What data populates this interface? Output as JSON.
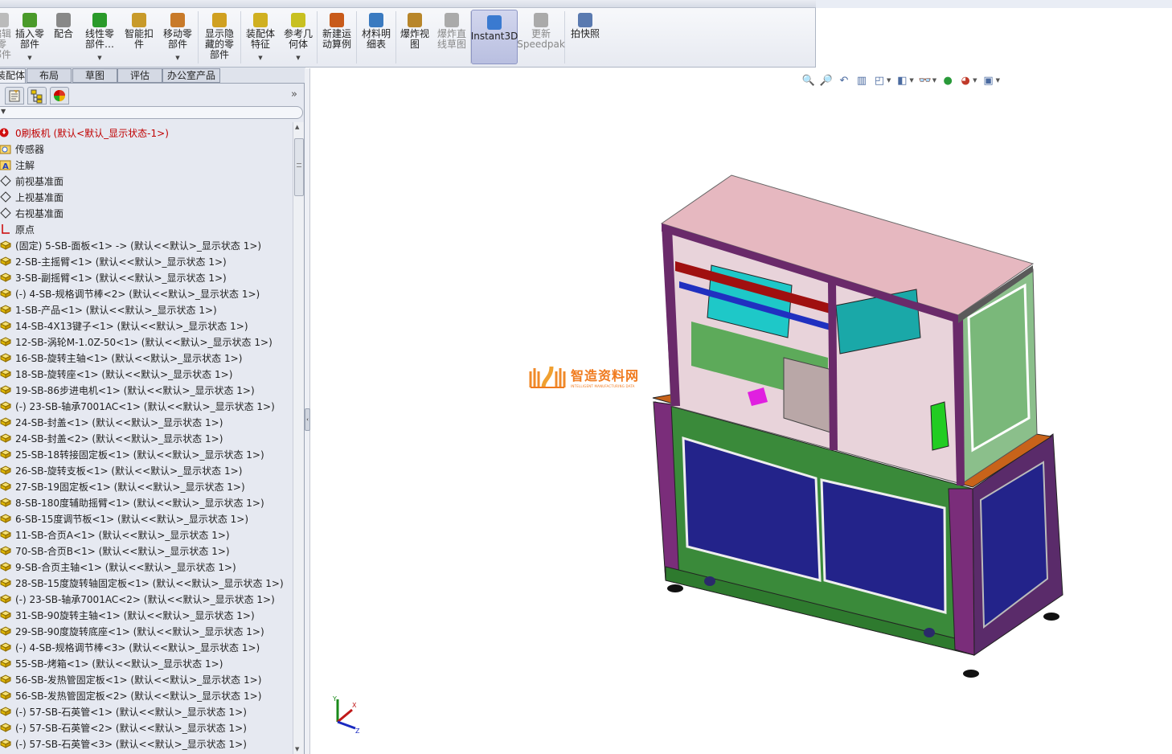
{
  "ribbon": {
    "items": [
      {
        "label": "编辑零\n部件",
        "disabled": true
      },
      {
        "label": "插入零\n部件",
        "dropdown": true
      },
      {
        "label": "配合"
      },
      {
        "label": "线性零\n部件…",
        "dropdown": true
      },
      {
        "label": "智能扣\n件"
      },
      {
        "label": "移动零\n部件",
        "dropdown": true
      },
      {
        "label": "显示隐\n藏的零\n部件"
      },
      {
        "label": "装配体\n特征",
        "dropdown": true
      },
      {
        "label": "参考几\n何体",
        "dropdown": true
      },
      {
        "label": "新建运\n动算例"
      },
      {
        "label": "材料明\n细表"
      },
      {
        "label": "爆炸视\n图"
      },
      {
        "label": "爆炸直\n线草图",
        "disabled": true
      },
      {
        "label": "Instant3D",
        "active": true
      },
      {
        "label": "更新\nSpeedpak",
        "disabled": true
      },
      {
        "label": "拍快照"
      }
    ]
  },
  "tabs": [
    {
      "label": "装配体",
      "active": true
    },
    {
      "label": "布局"
    },
    {
      "label": "草图"
    },
    {
      "label": "评估"
    },
    {
      "label": "办公室产品"
    }
  ],
  "panel_tools": [
    "property-manager-icon",
    "configuration-manager-icon",
    "display-manager-icon"
  ],
  "panel_expand": "»",
  "tree": {
    "root": "0刷板机  (默认<默认_显示状态-1>)",
    "items": [
      {
        "label": "传感器",
        "icon": "sensor-folder"
      },
      {
        "label": "注解",
        "icon": "annotation-folder"
      },
      {
        "label": "前视基准面",
        "icon": "plane"
      },
      {
        "label": "上视基准面",
        "icon": "plane"
      },
      {
        "label": "右视基准面",
        "icon": "plane"
      },
      {
        "label": "原点",
        "icon": "origin"
      },
      {
        "label": "(固定) 5-SB-面板<1> -> (默认<<默认>_显示状态 1>)",
        "icon": "part"
      },
      {
        "label": "2-SB-主摇臂<1> (默认<<默认>_显示状态 1>)",
        "icon": "part"
      },
      {
        "label": "3-SB-副摇臂<1> (默认<<默认>_显示状态 1>)",
        "icon": "part"
      },
      {
        "label": "(-) 4-SB-规格调节棒<2> (默认<<默认>_显示状态 1>)",
        "icon": "part"
      },
      {
        "label": "1-SB-产品<1> (默认<<默认>_显示状态 1>)",
        "icon": "part"
      },
      {
        "label": "14-SB-4X13键子<1> (默认<<默认>_显示状态 1>)",
        "icon": "part"
      },
      {
        "label": "12-SB-涡轮M-1.0Z-50<1> (默认<<默认>_显示状态 1>)",
        "icon": "part"
      },
      {
        "label": "16-SB-旋转主轴<1> (默认<<默认>_显示状态 1>)",
        "icon": "part"
      },
      {
        "label": "18-SB-旋转座<1> (默认<<默认>_显示状态 1>)",
        "icon": "part"
      },
      {
        "label": "19-SB-86步进电机<1> (默认<<默认>_显示状态 1>)",
        "icon": "part"
      },
      {
        "label": "(-) 23-SB-轴承7001AC<1> (默认<<默认>_显示状态 1>)",
        "icon": "part"
      },
      {
        "label": "24-SB-封盖<1> (默认<<默认>_显示状态 1>)",
        "icon": "part"
      },
      {
        "label": "24-SB-封盖<2> (默认<<默认>_显示状态 1>)",
        "icon": "part"
      },
      {
        "label": "25-SB-18转接固定板<1> (默认<<默认>_显示状态 1>)",
        "icon": "part"
      },
      {
        "label": "26-SB-旋转支板<1> (默认<<默认>_显示状态 1>)",
        "icon": "part"
      },
      {
        "label": "27-SB-19固定板<1> (默认<<默认>_显示状态 1>)",
        "icon": "part"
      },
      {
        "label": "8-SB-180度辅助摇臂<1> (默认<<默认>_显示状态 1>)",
        "icon": "part"
      },
      {
        "label": "6-SB-15度调节板<1> (默认<<默认>_显示状态 1>)",
        "icon": "part"
      },
      {
        "label": "11-SB-合页A<1> (默认<<默认>_显示状态 1>)",
        "icon": "part"
      },
      {
        "label": "70-SB-合页B<1> (默认<<默认>_显示状态 1>)",
        "icon": "part"
      },
      {
        "label": "9-SB-合页主轴<1> (默认<<默认>_显示状态 1>)",
        "icon": "part"
      },
      {
        "label": "28-SB-15度旋转轴固定板<1> (默认<<默认>_显示状态 1>)",
        "icon": "part"
      },
      {
        "label": "(-) 23-SB-轴承7001AC<2> (默认<<默认>_显示状态 1>)",
        "icon": "part"
      },
      {
        "label": "31-SB-90旋转主轴<1> (默认<<默认>_显示状态 1>)",
        "icon": "part"
      },
      {
        "label": "29-SB-90度旋转底座<1> (默认<<默认>_显示状态 1>)",
        "icon": "part"
      },
      {
        "label": "(-) 4-SB-规格调节棒<3> (默认<<默认>_显示状态 1>)",
        "icon": "part"
      },
      {
        "label": "55-SB-烤箱<1> (默认<<默认>_显示状态 1>)",
        "icon": "part"
      },
      {
        "label": "56-SB-发热管固定板<1> (默认<<默认>_显示状态 1>)",
        "icon": "part"
      },
      {
        "label": "56-SB-发热管固定板<2> (默认<<默认>_显示状态 1>)",
        "icon": "part"
      },
      {
        "label": "(-) 57-SB-石英管<1> (默认<<默认>_显示状态 1>)",
        "icon": "part"
      },
      {
        "label": "(-) 57-SB-石英管<2> (默认<<默认>_显示状态 1>)",
        "icon": "part"
      },
      {
        "label": "(-) 57-SB-石英管<3> (默认<<默认>_显示状态 1>)",
        "icon": "part"
      }
    ]
  },
  "view_toolbar": [
    "zoom-to-fit-icon",
    "zoom-to-area-icon",
    "previous-view-icon",
    "section-view-icon",
    "view-orientation-icon",
    "display-style-icon",
    "hide-show-items-icon",
    "edit-appearance-icon",
    "apply-scene-icon",
    "view-settings-icon"
  ],
  "watermark": {
    "title": "智造资料网",
    "subtitle": "INTELLIGENT MANUFACTURING DATA"
  },
  "triad": {
    "x": "X",
    "y": "Y",
    "z": "Z"
  },
  "colors": {
    "accent": "#b9bfe0",
    "root_text": "#c00000",
    "watermark": "#f07a1e"
  }
}
